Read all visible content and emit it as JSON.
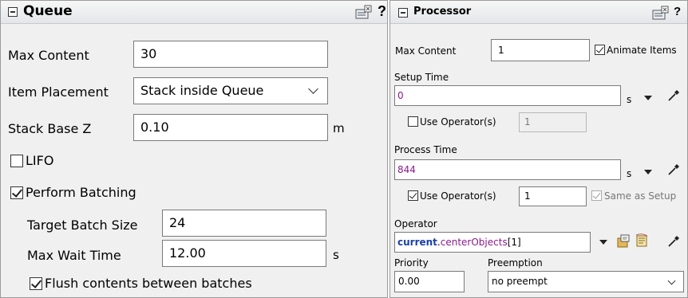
{
  "queue": {
    "title": "Queue",
    "help": "?",
    "max_content": {
      "label": "Max Content",
      "value": "30"
    },
    "item_placement": {
      "label": "Item Placement",
      "value": "Stack inside Queue"
    },
    "stack_base_z": {
      "label": "Stack Base Z",
      "value": "0.10",
      "unit": "m"
    },
    "lifo": {
      "label": "LIFO",
      "checked": false
    },
    "perform_batching": {
      "label": "Perform Batching",
      "checked": true
    },
    "target_batch_size": {
      "label": "Target Batch Size",
      "value": "24"
    },
    "max_wait_time": {
      "label": "Max Wait Time",
      "value": "12.00",
      "unit": "s"
    },
    "flush_contents": {
      "label": "Flush contents between batches",
      "checked": true
    }
  },
  "processor": {
    "title": "Processor",
    "help": "?",
    "max_content": {
      "label": "Max Content",
      "value": "1"
    },
    "animate_items": {
      "label": "Animate Items",
      "checked": true
    },
    "setup_time": {
      "label": "Setup Time",
      "value": "0",
      "unit": "s"
    },
    "setup_use_operators": {
      "label": "Use Operator(s)",
      "checked": false,
      "value": "1"
    },
    "process_time": {
      "label": "Process Time",
      "value": "844",
      "unit": "s"
    },
    "process_use_operators": {
      "label": "Use Operator(s)",
      "checked": true,
      "value": "1"
    },
    "same_as_setup": {
      "label": "Same as Setup",
      "checked": true
    },
    "operator": {
      "label": "Operator",
      "value_object": "current",
      "value_dot": ".",
      "value_member": "centerObjects",
      "value_index": "[1]"
    },
    "priority": {
      "label": "Priority",
      "value": "0.00"
    },
    "preemption": {
      "label": "Preemption",
      "value": "no preempt"
    }
  },
  "colors": {
    "code_purple": "#8b1a8b",
    "code_blue": "#1a3fa8",
    "panel_bg": "#f0f0f0"
  }
}
